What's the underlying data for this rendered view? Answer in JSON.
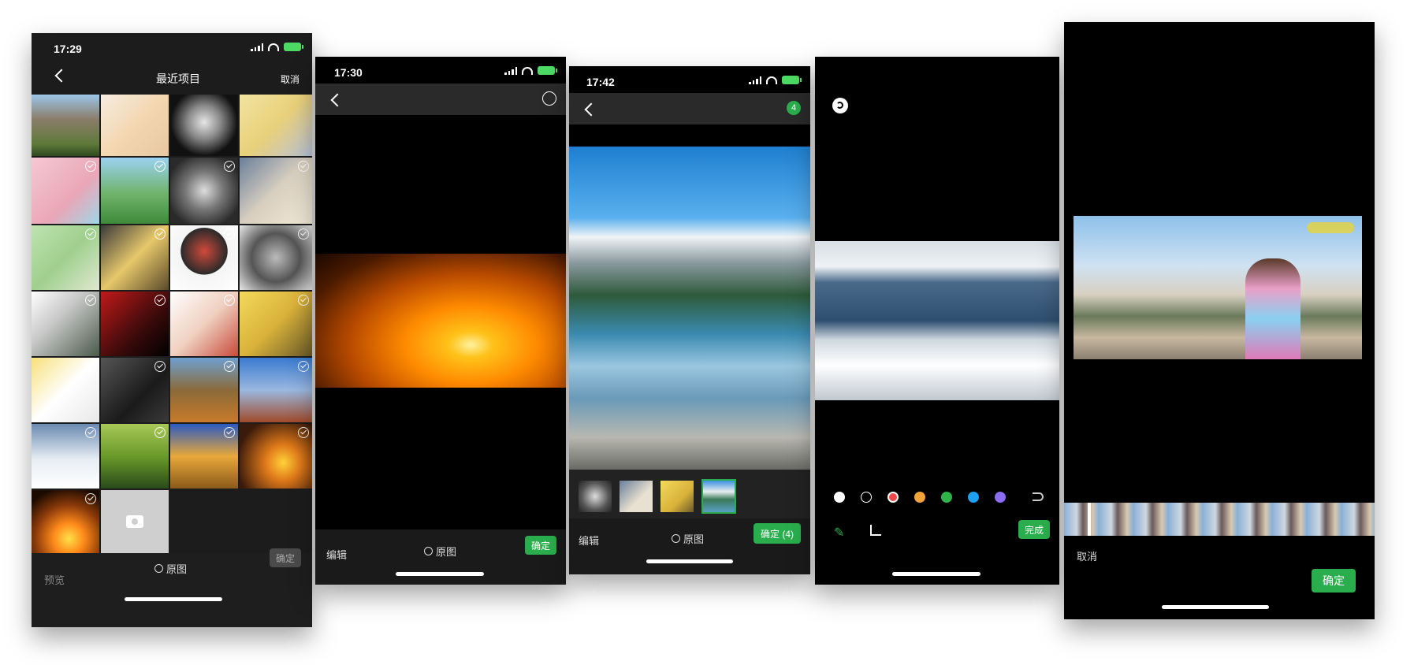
{
  "screen1": {
    "time": "17:29",
    "title": "最近项目",
    "cancel": "取消",
    "preview": "预览",
    "original": "原图",
    "confirm": "确定",
    "camera_icon": "camera-icon"
  },
  "screen2": {
    "time": "17:30",
    "edit": "编辑",
    "original": "原图",
    "confirm": "确定"
  },
  "screen3": {
    "time": "17:42",
    "badge": "4",
    "edit": "编辑",
    "original": "原图",
    "confirm": "确定 (4)"
  },
  "screen4": {
    "done": "完成",
    "colors": [
      "#ffffff",
      "#000000",
      "#f04848",
      "#f2a33a",
      "#2fb34a",
      "#1da1f2",
      "#8c6cf5"
    ]
  },
  "screen5": {
    "cancel": "取消",
    "confirm": "确定"
  }
}
